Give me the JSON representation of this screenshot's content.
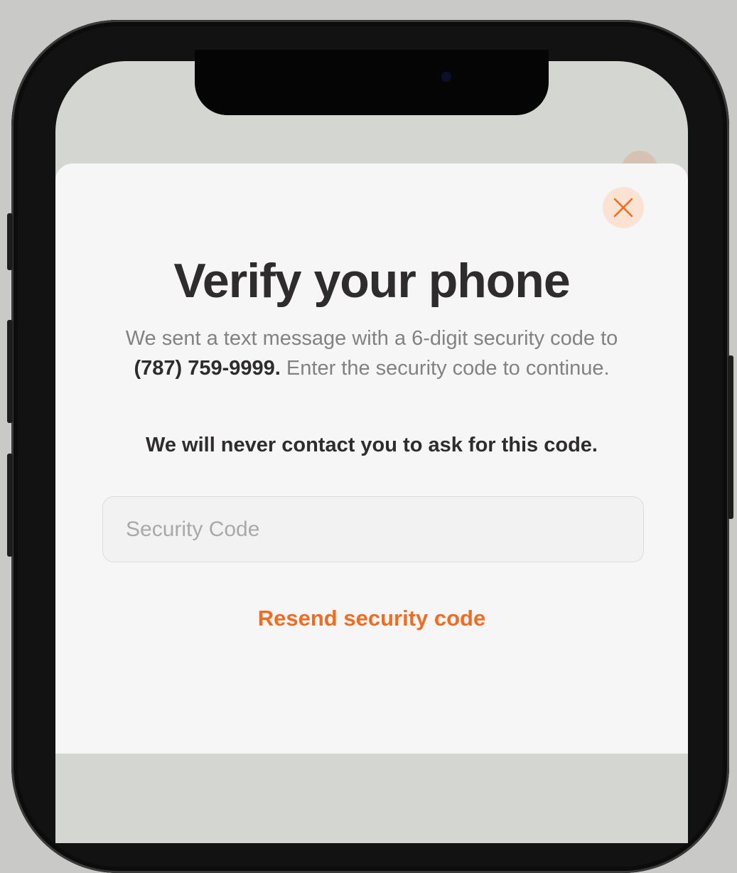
{
  "modal": {
    "title": "Verify your phone",
    "description_before": "We sent a text message with a 6-digit security code to ",
    "phone_number": "(787) 759-9999.",
    "description_after": " Enter the security code to continue.",
    "warning": "We will never contact you to ask for this code.",
    "code_input": {
      "placeholder": "Security Code",
      "value": ""
    },
    "resend_label": "Resend security code",
    "close_icon": "close-icon"
  },
  "colors": {
    "accent": "#ef6c22",
    "close_button_bg": "#fbe3d3",
    "text_primary": "#2e2c2d",
    "text_secondary": "#828282",
    "sheet_bg": "#f6f6f6"
  }
}
